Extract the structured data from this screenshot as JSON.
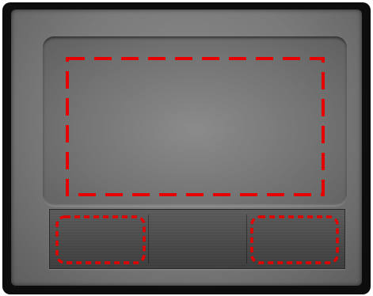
{
  "image": {
    "subject": "touchpad",
    "frame_color": "#0d0d0d",
    "bezel_color": "#7a7a7a",
    "surface_color": "#747474",
    "button_bar_color": "#4a4a4a"
  },
  "annotations": {
    "color": "#e60000",
    "style": "dashed",
    "regions": [
      "touch-area",
      "left-button",
      "right-button"
    ]
  }
}
